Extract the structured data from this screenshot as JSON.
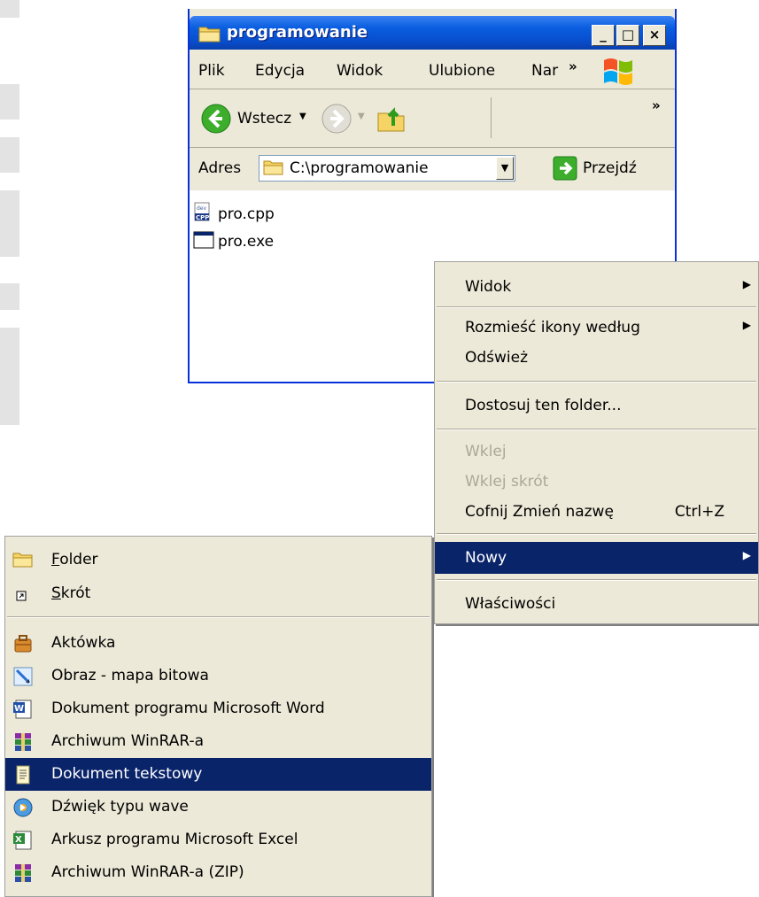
{
  "window": {
    "title": "programowanie",
    "minimize": "_",
    "maximize": "□",
    "close": "×",
    "menu": [
      "Plik",
      "Edycja",
      "Widok",
      "Ulubione",
      "Nar"
    ],
    "menu_more": "»",
    "toolbar": {
      "back_label": "Wstecz",
      "more": "»"
    },
    "address": {
      "label": "Adres",
      "path": "C:\\programowanie",
      "go_label": "Przejdź"
    },
    "files": [
      {
        "name": "pro.cpp",
        "icon": "cpp-file-icon"
      },
      {
        "name": "pro.exe",
        "icon": "exe-file-icon"
      }
    ]
  },
  "context_menu": {
    "view": "Widok",
    "arrange": "Rozmieść ikony według",
    "refresh": "Odśwież",
    "customize": "Dostosuj ten folder...",
    "paste": "Wklej",
    "paste_shortcut": "Wklej skrót",
    "undo": "Cofnij Zmień nazwę",
    "undo_shortcut": "Ctrl+Z",
    "new": "Nowy",
    "properties": "Właściwości",
    "arrow": "▶"
  },
  "new_submenu": {
    "folder": {
      "key": "F",
      "rest": "older"
    },
    "shortcut": {
      "key": "S",
      "rest": "krót"
    },
    "items": [
      {
        "label": "Aktówka",
        "icon": "briefcase-icon"
      },
      {
        "label": "Obraz - mapa bitowa",
        "icon": "bitmap-icon"
      },
      {
        "label": "Dokument programu Microsoft Word",
        "icon": "word-document-icon"
      },
      {
        "label": "Archiwum WinRAR-a",
        "icon": "winrar-icon"
      },
      {
        "label": "Dokument tekstowy",
        "icon": "text-document-icon"
      },
      {
        "label": "Dźwięk typu wave",
        "icon": "wave-sound-icon"
      },
      {
        "label": "Arkusz programu Microsoft Excel",
        "icon": "excel-sheet-icon"
      },
      {
        "label": "Archiwum WinRAR-a (ZIP)",
        "icon": "winrar-zip-icon"
      }
    ],
    "highlighted": "Dokument tekstowy"
  }
}
